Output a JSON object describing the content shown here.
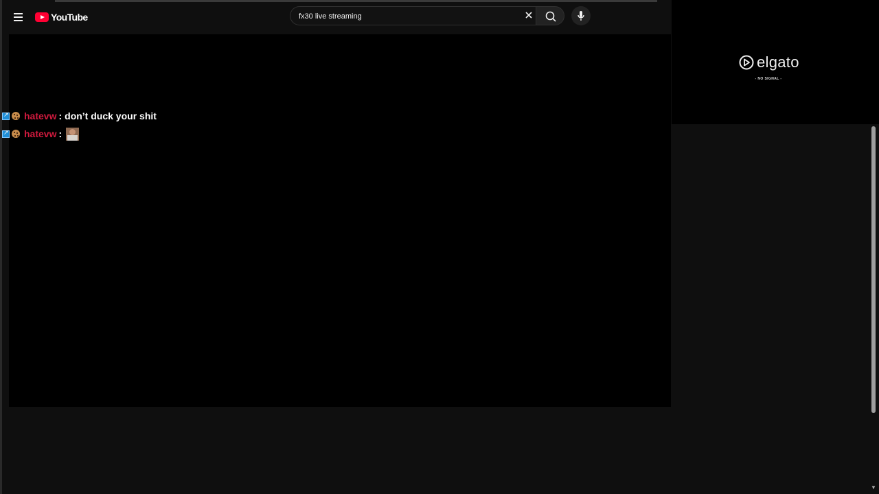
{
  "search": {
    "value": "fx30 live streaming"
  },
  "youtube": {
    "logo_text": "YouTube"
  },
  "elgato": {
    "brand": "elgato",
    "status": "- NO SIGNAL -"
  },
  "chat": {
    "messages": [
      {
        "username": "hatevw",
        "separator": ":",
        "text": "don’t duck your shit"
      },
      {
        "username": "hatevw",
        "separator": ":",
        "text": ""
      }
    ]
  },
  "icons": {
    "menu": "menu-icon",
    "clear": "close-icon",
    "search": "search-icon",
    "mic": "mic-icon"
  },
  "colors": {
    "page_bg": "#0f0f0f",
    "player_bg": "#000000",
    "username": "#d11a3e",
    "youtube_red": "#ff0033"
  }
}
